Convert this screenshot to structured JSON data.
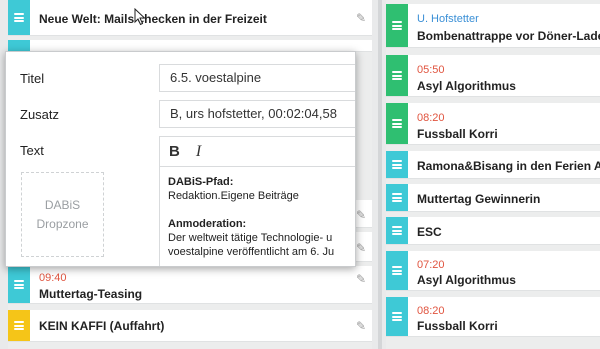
{
  "colors": {
    "teal": "#3ec9d6",
    "green": "#2fbf71",
    "yellow": "#f5c518",
    "time_red": "#e0543f",
    "time_blue": "#3a8fd6"
  },
  "left_column": {
    "cards": [
      {
        "time": "",
        "title": "Neue Welt: Mails checken in der Freizeit",
        "stripe": "teal"
      },
      {
        "time": "09:40",
        "title": "Muttertag-Teasing",
        "stripe": "teal"
      },
      {
        "time": "",
        "title": "KEIN KAFFI (Auffahrt)",
        "stripe": "yellow"
      }
    ]
  },
  "right_column": {
    "cards": [
      {
        "time": "U. Hofstetter",
        "title": "Bombenattrappe vor Döner-Laden in",
        "stripe": "green",
        "time_color": "time_blue"
      },
      {
        "time": "05:50",
        "title": "Asyl Algorithmus",
        "stripe": "green",
        "time_color": "time_red"
      },
      {
        "time": "08:20",
        "title": "Fussball Korri",
        "stripe": "green",
        "time_color": "time_red"
      },
      {
        "time": "",
        "title": "Ramona&Bisang in den Ferien Arma",
        "stripe": "teal"
      },
      {
        "time": "",
        "title": "Muttertag Gewinnerin",
        "stripe": "teal"
      },
      {
        "time": "",
        "title": "ESC",
        "stripe": "teal"
      },
      {
        "time": "07:20",
        "title": "Asyl Algorithmus",
        "stripe": "teal",
        "time_color": "time_red"
      },
      {
        "time": "08:20",
        "title": "Fussball Korri",
        "stripe": "teal",
        "time_color": "time_red"
      }
    ]
  },
  "popup": {
    "titel_label": "Titel",
    "titel_value": "6.5. voestalpine",
    "zusatz_label": "Zusatz",
    "zusatz_value": "B, urs hofstetter, 00:02:04,58",
    "text_label": "Text",
    "dropzone_line1": "DABiS",
    "dropzone_line2": "Dropzone",
    "toolbar": {
      "bold": "B",
      "italic": "I"
    },
    "editor": {
      "heading1": "DABiS-Pfad:",
      "line1": "Redaktion.Eigene Beiträge",
      "heading2": "Anmoderation:",
      "line2": "Der weltweit tätige Technologie- u",
      "line3": "voestalpine veröffentlicht am 6. Ju"
    }
  }
}
